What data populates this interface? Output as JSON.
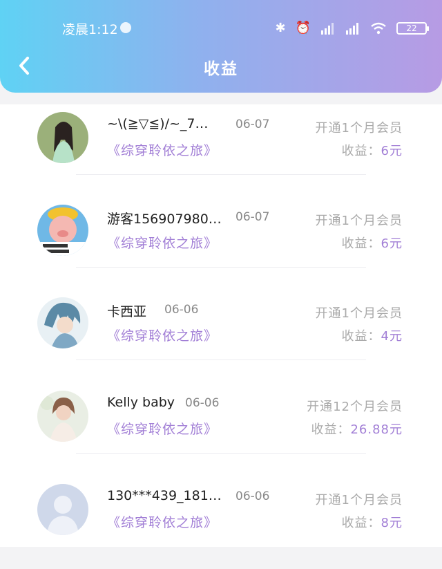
{
  "status": {
    "time": "凌晨1:12",
    "battery": "22"
  },
  "header": {
    "title": "收益"
  },
  "colors": {
    "accent": "#a27fd6",
    "header_start": "#5fd2f4",
    "header_end": "#b79be4"
  },
  "records": [
    {
      "name": "~\\(≧▽≦)/~_7…",
      "date": "06-07",
      "book": "《综穿聆依之旅》",
      "plan": "开通1个月会员",
      "income_label": "收益：",
      "income_value": "6元",
      "avatar": "woman-photo-avatar"
    },
    {
      "name": "游客156907980…",
      "date": "06-07",
      "book": "《综穿聆依之旅》",
      "plan": "开通1个月会员",
      "income_label": "收益：",
      "income_value": "6元",
      "avatar": "cartoon-pig-avatar"
    },
    {
      "name": "卡西亚",
      "date": "06-06",
      "book": "《综穿聆依之旅》",
      "plan": "开通1个月会员",
      "income_label": "收益：",
      "income_value": "4元",
      "avatar": "anime-character-avatar"
    },
    {
      "name": "Kelly baby",
      "date": "06-06",
      "book": "《综穿聆依之旅》",
      "plan": "开通12个月会员",
      "income_label": "收益：",
      "income_value": "26.88元",
      "avatar": "woman-photo-avatar"
    },
    {
      "name": "130***439_181…",
      "date": "06-06",
      "book": "《综穿聆依之旅》",
      "plan": "开通1个月会员",
      "income_label": "收益：",
      "income_value": "8元",
      "avatar": "default-user-avatar"
    }
  ]
}
